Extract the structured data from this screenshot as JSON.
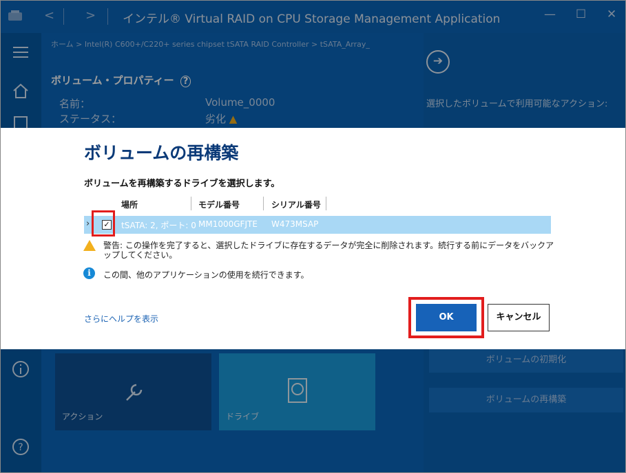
{
  "app": {
    "title": "インテル® Virtual RAID on CPU Storage Management Application"
  },
  "breadcrumb": "ホーム > Intel(R) C600+/C220+ series chipset tSATA RAID Controller > tSATA_Array_",
  "volume_properties": {
    "heading": "ボリューム・プロパティー",
    "name_label": "名前：",
    "name_value": "Volume_0000",
    "status_label": "ステータス：",
    "status_value": "劣化"
  },
  "tiles": [
    {
      "label": "アクション",
      "icon": "wrench-icon"
    },
    {
      "label": "ドライブ",
      "icon": "drive-icon"
    }
  ],
  "right_panel": {
    "title": "選択したボリュームで利用可能なアクション:",
    "buttons": [
      {
        "label": "ボリュームの初期化"
      },
      {
        "label": "ボリュームの再構築"
      }
    ]
  },
  "dialog": {
    "title": "ボリュームの再構築",
    "subtitle": "ボリュームを再構築するドライブを選択します。",
    "columns": [
      "場所",
      "モデル番号",
      "シリアル番号"
    ],
    "rows": [
      {
        "location": "tSATA: 2, ポート: 0",
        "model": "MM1000GFJTE",
        "serial": "W473MSAP",
        "checked": true
      }
    ],
    "warning": "警告: この操作を完了すると、選択したドライブに存在するデータが完全に削除されます。続行する前にデータをバックアップしてください。",
    "info": "この間、他のアプリケーションの使用を続行できます。",
    "help_link": "さらにヘルプを表示",
    "ok_label": "OK",
    "cancel_label": "キャンセル"
  },
  "colors": {
    "accent": "#0b65b8",
    "highlight": "#e21d1d",
    "selected_row": "#a9d8f5",
    "warning": "#f2b01e"
  }
}
